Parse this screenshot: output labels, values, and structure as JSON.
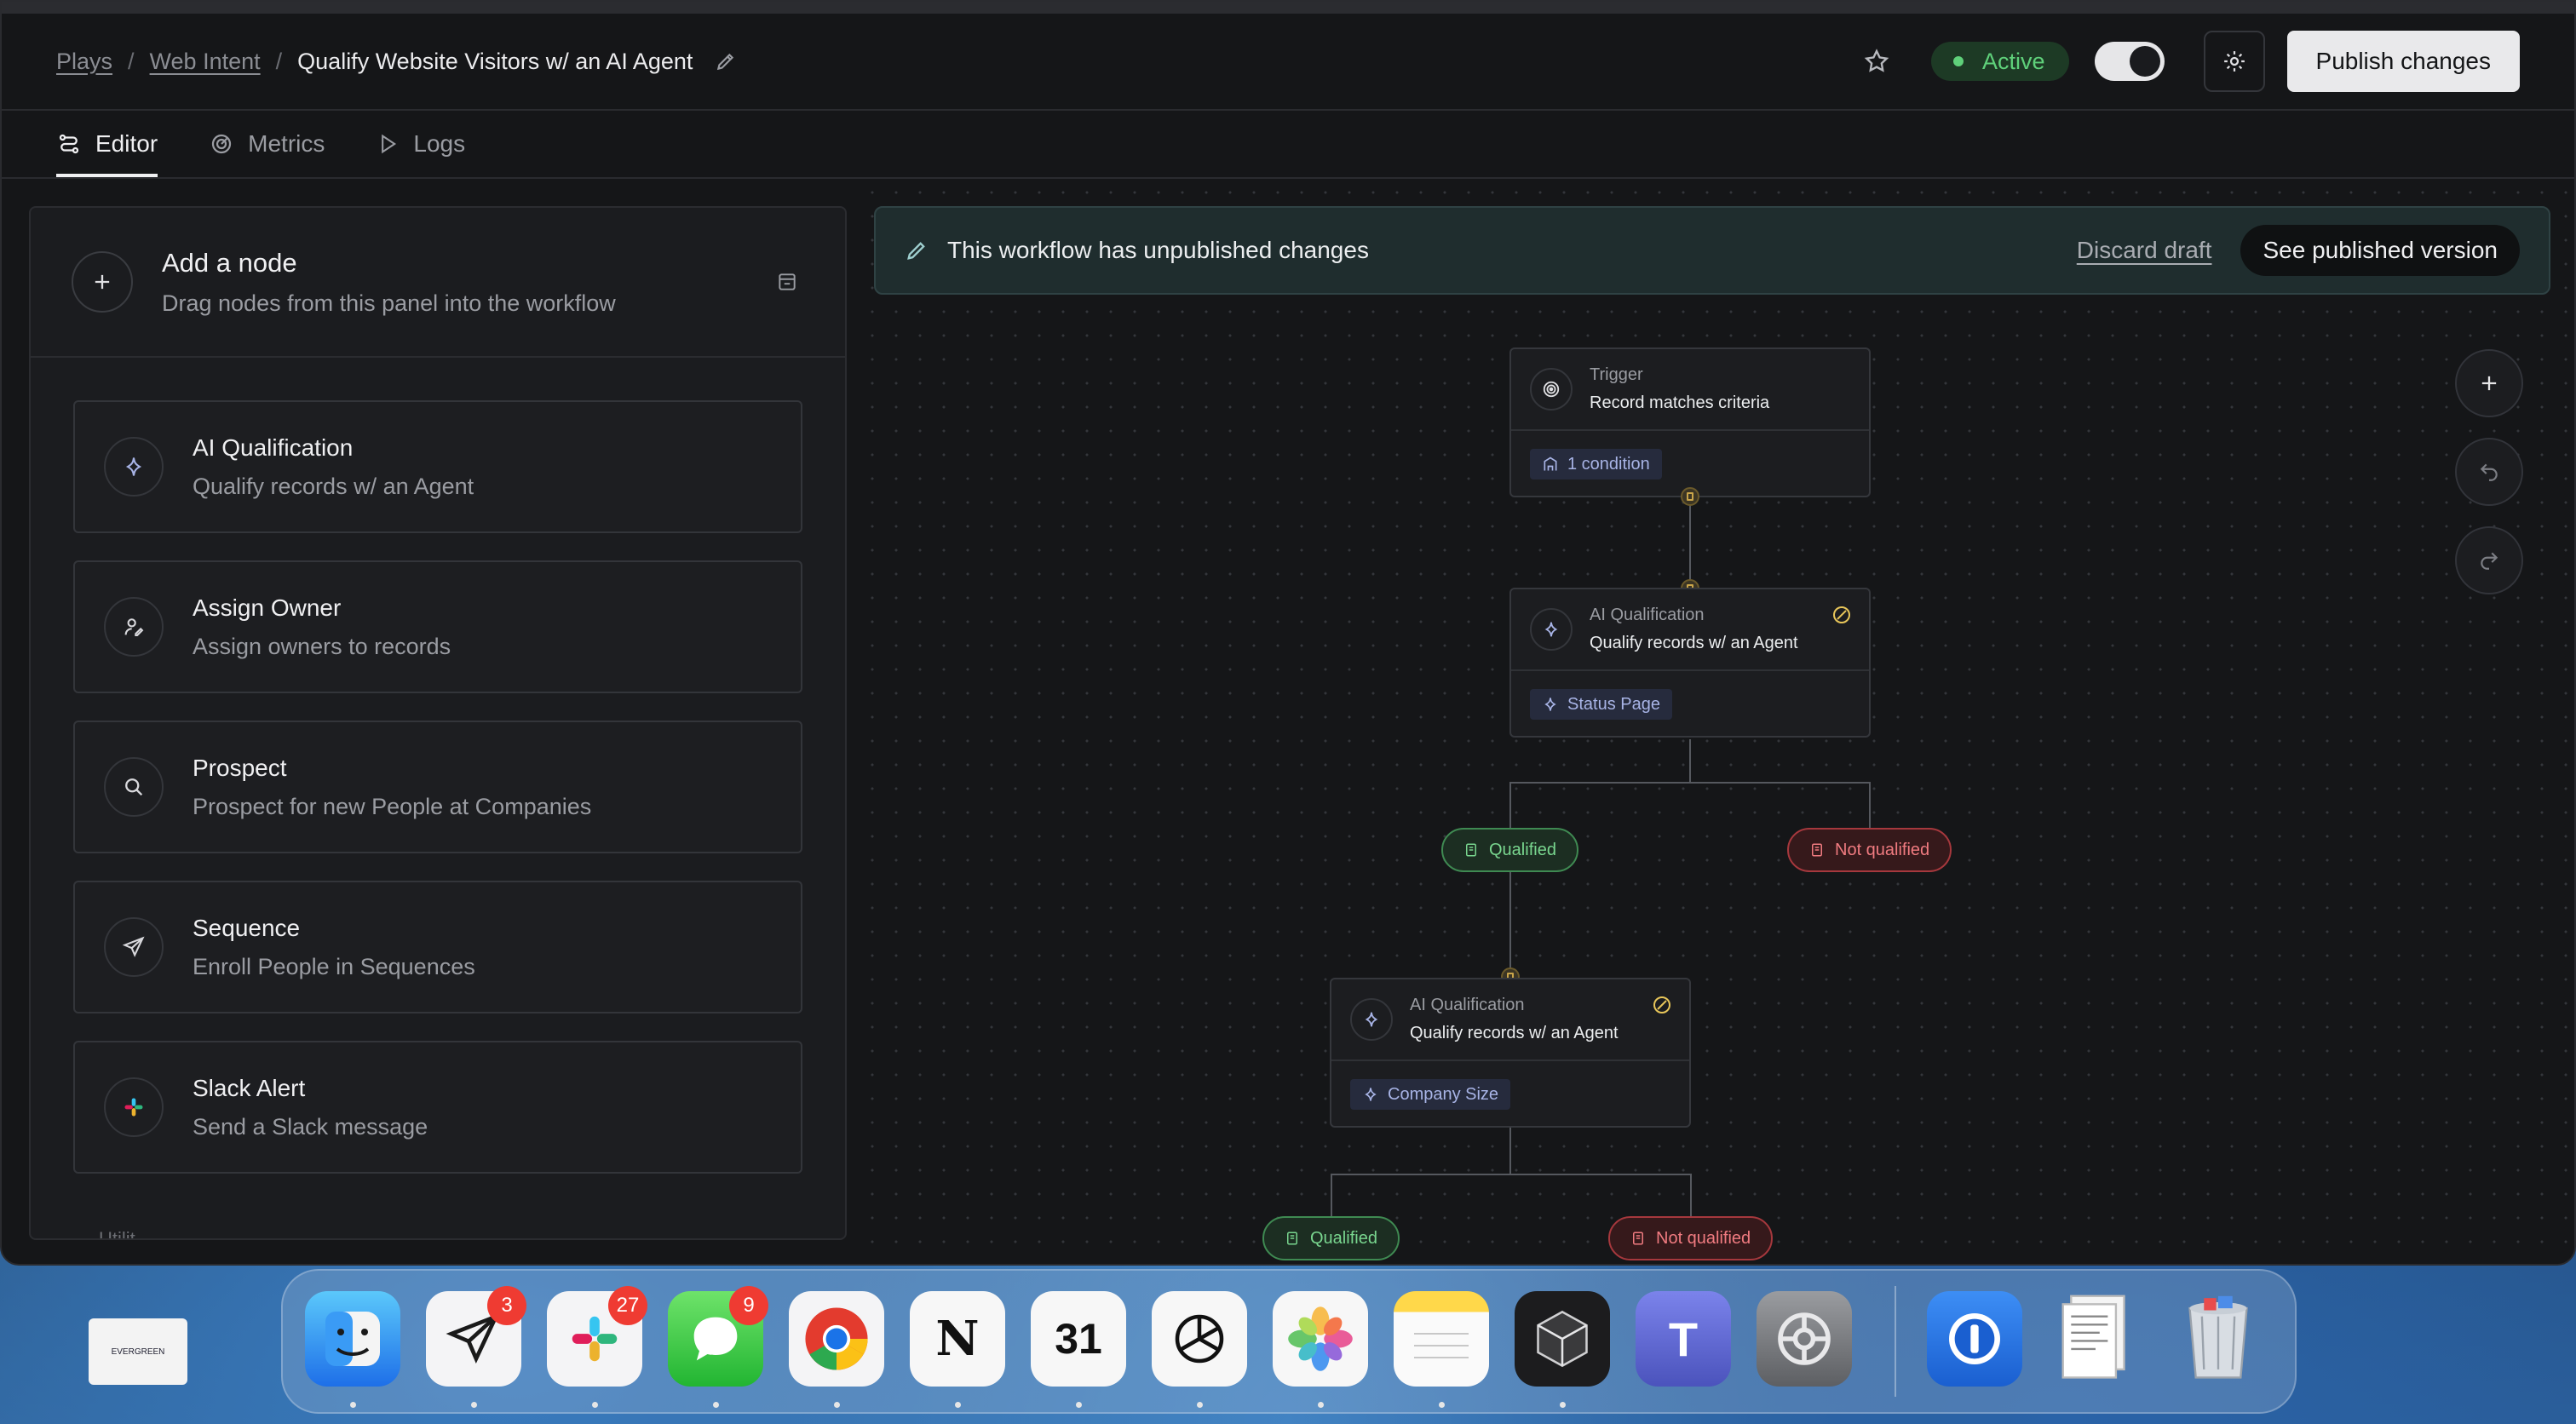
{
  "header": {
    "breadcrumbs": [
      "Plays",
      "Web Intent"
    ],
    "separator": "/",
    "current": "Qualify Website Visitors w/ an AI Agent",
    "status": "Active",
    "publish_label": "Publish changes"
  },
  "tabs": [
    {
      "label": "Editor",
      "icon": "editor-icon",
      "active": true
    },
    {
      "label": "Metrics",
      "icon": "metrics-icon",
      "active": false
    },
    {
      "label": "Logs",
      "icon": "play-icon",
      "active": false
    }
  ],
  "panel": {
    "title": "Add a node",
    "subtitle": "Drag nodes from this panel into the workflow",
    "nodes": [
      {
        "title": "AI Qualification",
        "desc": "Qualify records w/ an Agent",
        "icon": "sparkle-icon"
      },
      {
        "title": "Assign Owner",
        "desc": "Assign owners to records",
        "icon": "assign-user-icon"
      },
      {
        "title": "Prospect",
        "desc": "Prospect for new People at Companies",
        "icon": "search-icon"
      },
      {
        "title": "Sequence",
        "desc": "Enroll People in Sequences",
        "icon": "send-icon"
      },
      {
        "title": "Slack Alert",
        "desc": "Send a Slack message",
        "icon": "slack-icon"
      }
    ],
    "cut_label": "Utilit"
  },
  "banner": {
    "text": "This workflow has unpublished changes",
    "discard": "Discard draft",
    "see_published": "See published version"
  },
  "flow": {
    "trigger": {
      "kind": "Trigger",
      "title": "Record matches criteria",
      "chip": "1 condition"
    },
    "qual1": {
      "kind": "AI Qualification",
      "title": "Qualify records w/ an Agent",
      "chip": "Status Page"
    },
    "qual2": {
      "kind": "AI Qualification",
      "title": "Qualify records w/ an Agent",
      "chip": "Company Size"
    },
    "qualified": "Qualified",
    "not_qualified": "Not qualified"
  },
  "dock": {
    "desktop_file": "EVERGREEN",
    "apps": [
      {
        "name": "Finder",
        "badge": ""
      },
      {
        "name": "Telegram",
        "badge": "3"
      },
      {
        "name": "Slack",
        "badge": "27"
      },
      {
        "name": "Messages",
        "badge": "9"
      },
      {
        "name": "Chrome",
        "badge": ""
      },
      {
        "name": "Notion",
        "badge": ""
      },
      {
        "name": "Calendar",
        "badge": ""
      },
      {
        "name": "ChatGPT",
        "badge": ""
      },
      {
        "name": "Photos",
        "badge": ""
      },
      {
        "name": "Notes",
        "badge": ""
      },
      {
        "name": "Cursor",
        "badge": ""
      },
      {
        "name": "Teams",
        "badge": ""
      },
      {
        "name": "System Settings",
        "badge": ""
      },
      {
        "name": "1Password",
        "badge": ""
      },
      {
        "name": "Documents",
        "badge": ""
      },
      {
        "name": "Trash",
        "badge": ""
      }
    ],
    "notion_glyph": "N",
    "calendar_glyph": "31",
    "teams_glyph": "T"
  },
  "colors": {
    "accent_green": "#5fd07a",
    "danger_red": "#f07b80",
    "chip_blue": "#a8b4e6"
  }
}
